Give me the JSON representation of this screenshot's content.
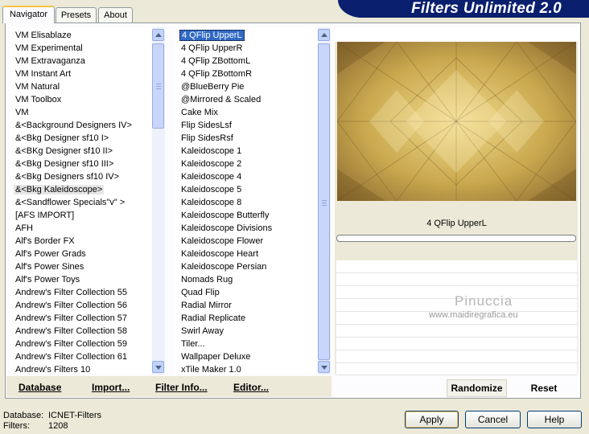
{
  "banner": {
    "title": "Filters Unlimited 2.0"
  },
  "tabs": [
    {
      "label": "Navigator",
      "active": true
    },
    {
      "label": "Presets",
      "active": false
    },
    {
      "label": "About",
      "active": false
    }
  ],
  "categories": [
    "VM Elisablaze",
    "VM Experimental",
    "VM Extravaganza",
    "VM Instant Art",
    "VM Natural",
    "VM Toolbox",
    "VM",
    "&<Background Designers IV>",
    "&<Bkg Designer sf10 I>",
    "&<BKg Designer sf10 II>",
    "&<Bkg Designer sf10 III>",
    "&<Bkg Designers sf10 IV>",
    "&<Bkg Kaleidoscope>",
    "&<Sandflower Specials\"v\" >",
    "[AFS IMPORT]",
    "AFH",
    "Alf's Border FX",
    "Alf's Power Grads",
    "Alf's Power Sines",
    "Alf's Power Toys",
    "Andrew's Filter Collection 55",
    "Andrew's Filter Collection 56",
    "Andrew's Filter Collection 57",
    "Andrew's Filter Collection 58",
    "Andrew's Filter Collection 59",
    "Andrew's Filter Collection 61",
    "Andrew's Filters 10"
  ],
  "categories_selected": "&<Bkg Kaleidoscope>",
  "filters": [
    "4 QFlip UpperL",
    "4 QFlip UpperR",
    "4 QFlip ZBottomL",
    "4 QFlip ZBottomR",
    "@BlueBerry Pie",
    "@Mirrored & Scaled",
    "Cake Mix",
    "Flip SidesLsf",
    "Flip SidesRsf",
    "Kaleidoscope 1",
    "Kaleidoscope 2",
    "Kaleidoscope 4",
    "Kaleidoscope 5",
    "Kaleidoscope 8",
    "Kaleidoscope Butterfly",
    "Kaleidoscope Divisions",
    "Kaleidoscope Flower",
    "Kaleidoscope Heart",
    "Kaleidoscope Persian",
    "Nomads Rug",
    "Quad Flip",
    "Radial Mirror",
    "Radial Replicate",
    "Swirl Away",
    "Tiler...",
    "Wallpaper Deluxe",
    "xTile Maker 1.0"
  ],
  "filters_selected": "4 QFlip UpperL",
  "left_buttons": {
    "database": "Database",
    "import": "Import...",
    "filter_info": "Filter Info...",
    "editor": "Editor..."
  },
  "preview": {
    "filter_name": "4 QFlip UpperL",
    "watermark_name": "Pinuccia",
    "watermark_url": "www.maidiregrafica.eu"
  },
  "right_buttons": {
    "randomize": "Randomize",
    "reset": "Reset"
  },
  "status": {
    "database_label": "Database:",
    "database_value": "ICNET-Filters",
    "filters_label": "Filters:",
    "filters_value": "1208"
  },
  "footer": {
    "apply": "Apply",
    "cancel": "Cancel",
    "help": "Help"
  },
  "colors": {
    "banner": "#0a1f6e",
    "selection": "#316ac5",
    "scrollbar": "#c1d3fb"
  }
}
